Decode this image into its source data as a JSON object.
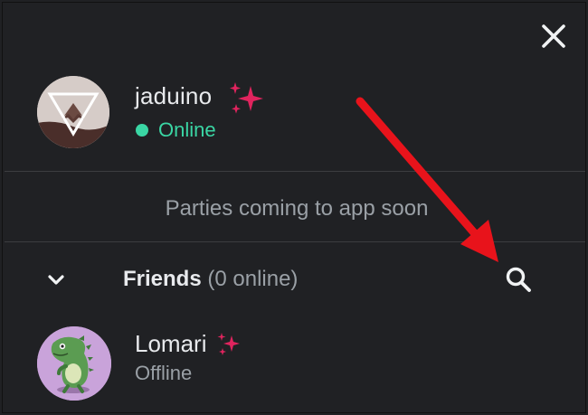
{
  "profile": {
    "username": "jaduino",
    "status": "Online",
    "status_color": "#3ad6a4"
  },
  "party": {
    "message": "Parties coming to app soon"
  },
  "friends": {
    "title": "Friends",
    "count_label": "(0 online)",
    "items": [
      {
        "name": "Lomari",
        "status": "Offline"
      }
    ]
  },
  "icons": {
    "close": "close-icon",
    "collapse": "chevron-down-icon",
    "search": "search-icon",
    "nitro": "sparkle-icon"
  },
  "colors": {
    "background": "#202124",
    "annotation_arrow": "#e8131b",
    "sparkle": "#e0245e"
  }
}
